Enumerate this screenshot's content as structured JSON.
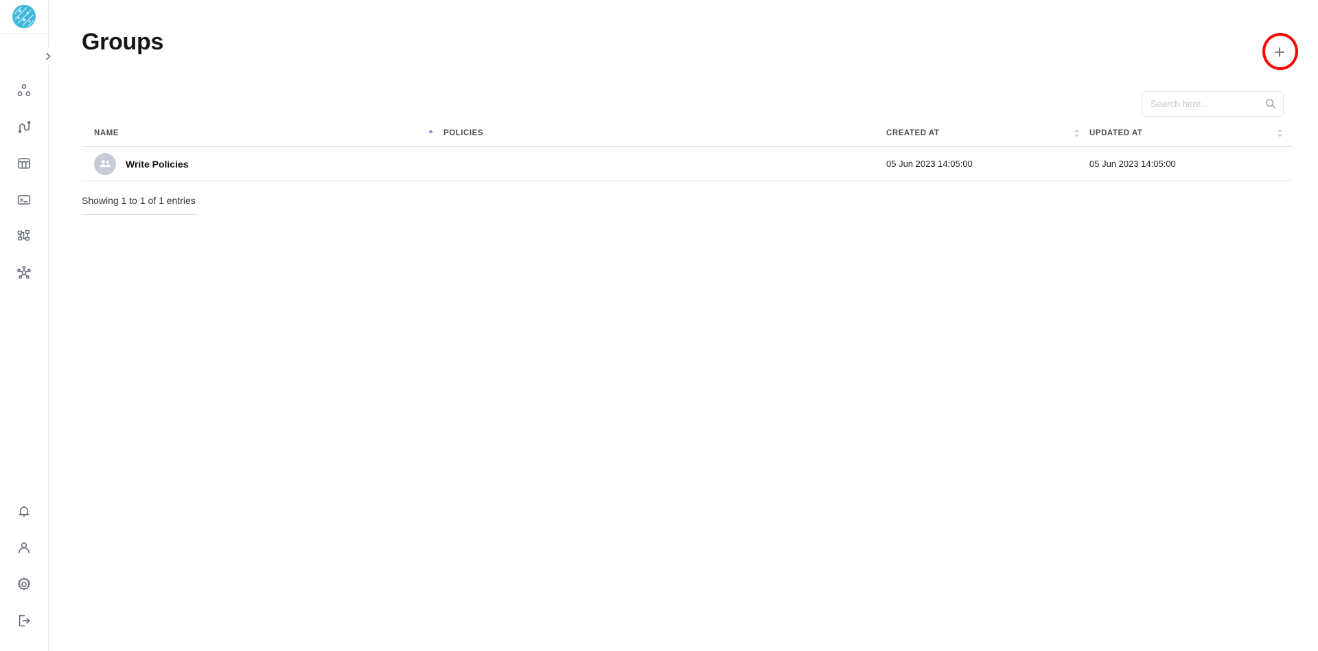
{
  "app": {
    "logo_name": "network-circle-logo",
    "accent_color": "#3fb8d9",
    "sort_active_color": "#7b78d6",
    "highlight_color": "#ff0000"
  },
  "sidebar": {
    "collapse_label": "›",
    "top_items": [
      {
        "icon": "clusters-icon",
        "name": "sidebar-item-clusters"
      },
      {
        "icon": "connections-icon",
        "name": "sidebar-item-connections"
      },
      {
        "icon": "tables-icon",
        "name": "sidebar-item-tables"
      },
      {
        "icon": "console-icon",
        "name": "sidebar-item-console"
      },
      {
        "icon": "sitemap-icon",
        "name": "sidebar-item-sitemap"
      },
      {
        "icon": "network-hub-icon",
        "name": "sidebar-item-network"
      }
    ],
    "bottom_items": [
      {
        "icon": "bell-icon",
        "name": "sidebar-item-notifications"
      },
      {
        "icon": "user-icon",
        "name": "sidebar-item-profile"
      },
      {
        "icon": "gear-icon",
        "name": "sidebar-item-settings"
      },
      {
        "icon": "logout-icon",
        "name": "sidebar-item-logout"
      }
    ]
  },
  "header": {
    "title": "Groups",
    "add_button_label": "+"
  },
  "search": {
    "placeholder": "Search here...",
    "value": "",
    "icon": "search-icon"
  },
  "table": {
    "columns": [
      {
        "label": "NAME",
        "sort": "asc"
      },
      {
        "label": "POLICIES",
        "sort": "none"
      },
      {
        "label": "CREATED AT",
        "sort": "both"
      },
      {
        "label": "UPDATED AT",
        "sort": "both"
      }
    ],
    "rows": [
      {
        "avatar": "group-avatar-icon",
        "name": "Write Policies",
        "policies": "",
        "created_at": "05 Jun 2023 14:05:00",
        "updated_at": "05 Jun 2023 14:05:00"
      }
    ],
    "footer": "Showing 1 to 1 of 1 entries"
  }
}
